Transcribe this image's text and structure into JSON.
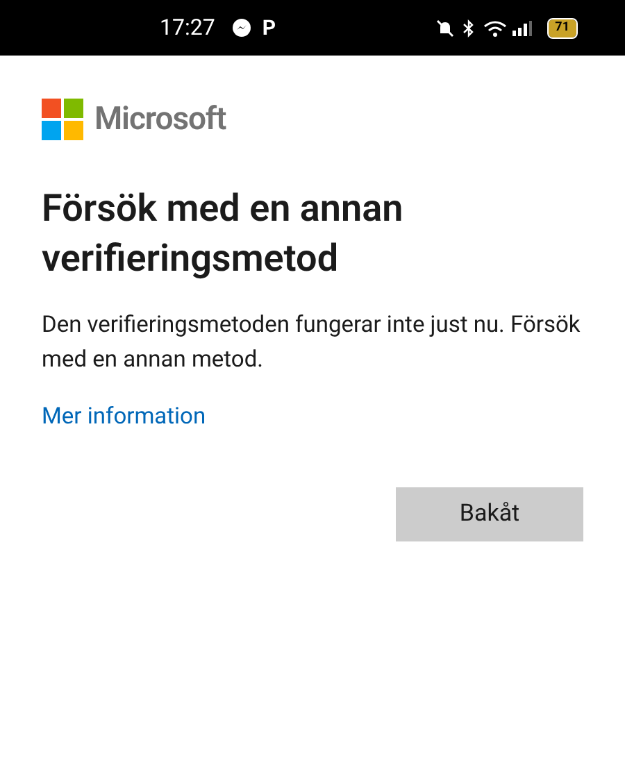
{
  "status_bar": {
    "time": "17:27",
    "notification_letter": "P",
    "battery": "71"
  },
  "brand": {
    "name": "Microsoft"
  },
  "title": "Försök med en annan verifieringsmetod",
  "message": "Den verifieringsmetoden fungerar inte just nu. Försök med en annan metod.",
  "link": "Mer information",
  "buttons": [
    {
      "label": "Bakåt"
    }
  ]
}
